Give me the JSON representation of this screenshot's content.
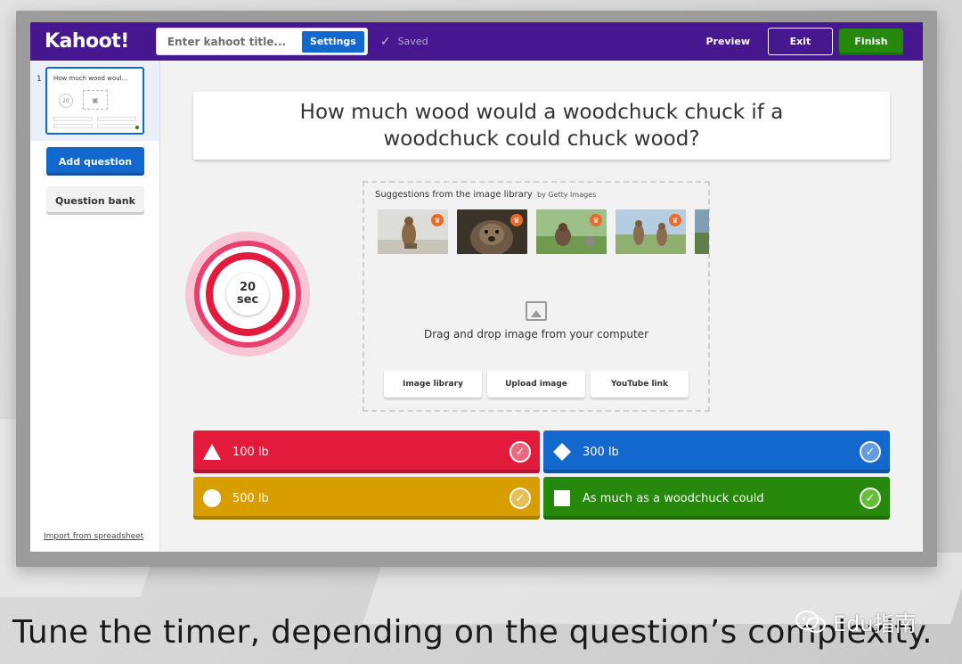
{
  "app": {
    "logo": "Kahoot!",
    "title_placeholder": "Enter kahoot title...",
    "settings_label": "Settings",
    "saved_label": "Saved",
    "preview_label": "Preview",
    "exit_label": "Exit",
    "finish_label": "Finish"
  },
  "sidebar": {
    "slide_number": "1",
    "slide_title": "How much wood woul...",
    "slide_timer": "20",
    "add_question_label": "Add question",
    "question_bank_label": "Question bank",
    "import_label": "Import from spreadsheet"
  },
  "question": {
    "text": "How much wood would a woodchuck chuck if a woodchuck could chuck wood?"
  },
  "timer": {
    "value": "20",
    "unit": "sec"
  },
  "media": {
    "suggestions_label": "Suggestions from the image library",
    "provider": "by Getty Images",
    "drag_text": "Drag and drop image from your computer",
    "buttons": [
      "Image library",
      "Upload image",
      "YouTube link"
    ]
  },
  "answers": [
    {
      "shape": "triangle-icon",
      "label": "100 lb",
      "correct": false,
      "color": "#e21b3c"
    },
    {
      "shape": "diamond-icon",
      "label": "300 lb",
      "correct": false,
      "color": "#1368ce"
    },
    {
      "shape": "circle-icon",
      "label": "500 lb",
      "correct": false,
      "color": "#d89e00"
    },
    {
      "shape": "square-icon",
      "label": "As much as a woodchuck could",
      "correct": true,
      "color": "#26890c"
    }
  ],
  "caption": "Tune the timer, depending on the question’s complexity.",
  "watermark": "Edu指南",
  "colors": {
    "brand_purple": "#46178f",
    "primary_blue": "#1368ce",
    "finish_green": "#26890c",
    "timer_pink": "#e21b3c"
  }
}
